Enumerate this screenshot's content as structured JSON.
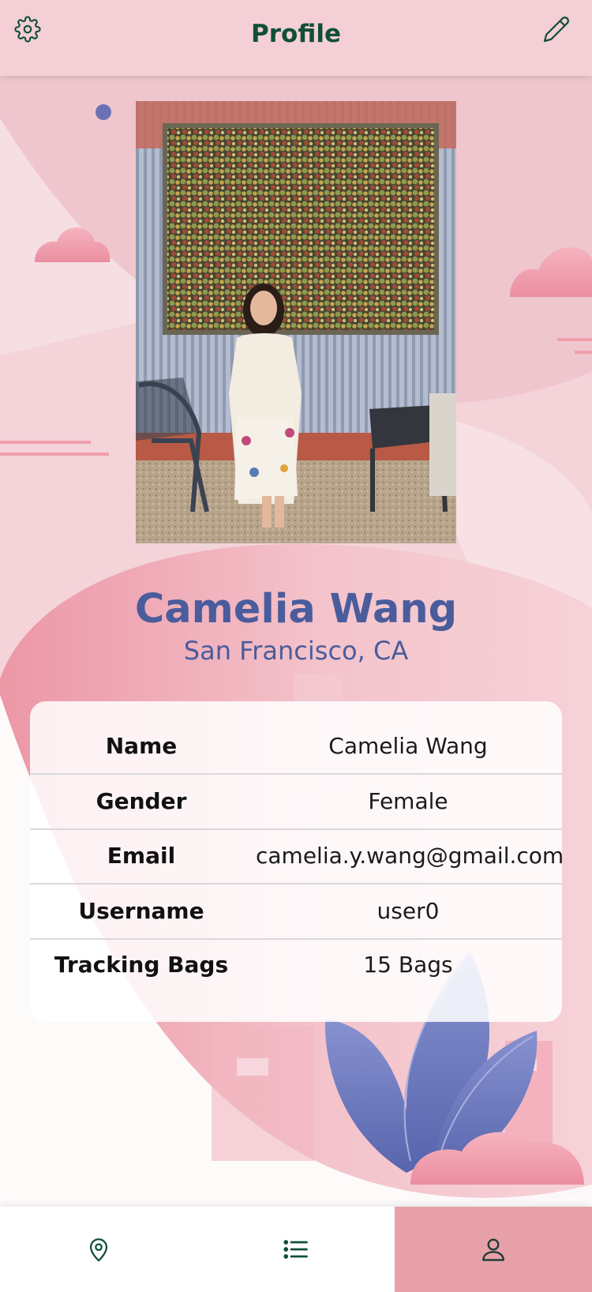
{
  "header": {
    "title": "Profile"
  },
  "profile": {
    "name": "Camelia Wang",
    "location": "San Francisco, CA"
  },
  "details": [
    {
      "label": "Name",
      "value": "Camelia Wang"
    },
    {
      "label": "Gender",
      "value": "Female"
    },
    {
      "label": "Email",
      "value": "camelia.y.wang@gmail.com"
    },
    {
      "label": "Username",
      "value": "user0"
    },
    {
      "label": "Tracking Bags",
      "value": "15 Bags"
    }
  ],
  "nav": {
    "items": [
      "location-pin-icon",
      "list-icon",
      "user-icon"
    ],
    "active": "user-icon"
  },
  "colors": {
    "primary_green": "#0f4f3a",
    "accent_blue": "#4a5c9c",
    "nav_active": "#e8a1a9"
  }
}
